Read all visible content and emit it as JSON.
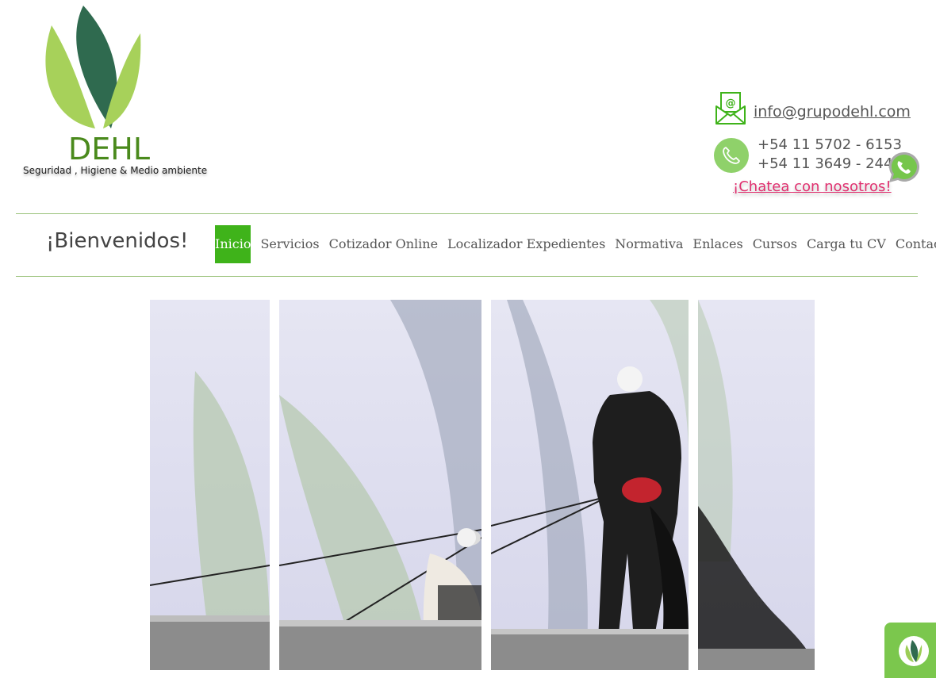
{
  "logo": {
    "title": "DEHL",
    "subtitle": "Seguridad , Higiene & Medio ambiente"
  },
  "contact": {
    "email": "info@grupodehl.com",
    "phone1": "+54 11 5702 - 6153",
    "phone2": "+54 11 3649 - 2447",
    "chat_link": "¡Chatea con nosotros!"
  },
  "welcome": "¡Bienvenidos!",
  "nav": {
    "items": [
      "Inicio",
      "Servicios",
      "Cotizador Online",
      "Localizador Expedientes",
      "Normativa",
      "Enlaces",
      "Cursos",
      "Carga tu CV",
      "Contacto"
    ],
    "active": "Inicio"
  },
  "icons": [
    "leaf-logo-icon",
    "mail-icon",
    "phone-icon",
    "whatsapp-icon",
    "leaf-badge-icon"
  ],
  "colors": {
    "brand_green": "#3fb31a",
    "dark_green": "#2f6a4f",
    "light_green": "#9ccd56",
    "chat_pink": "#e0306f"
  }
}
